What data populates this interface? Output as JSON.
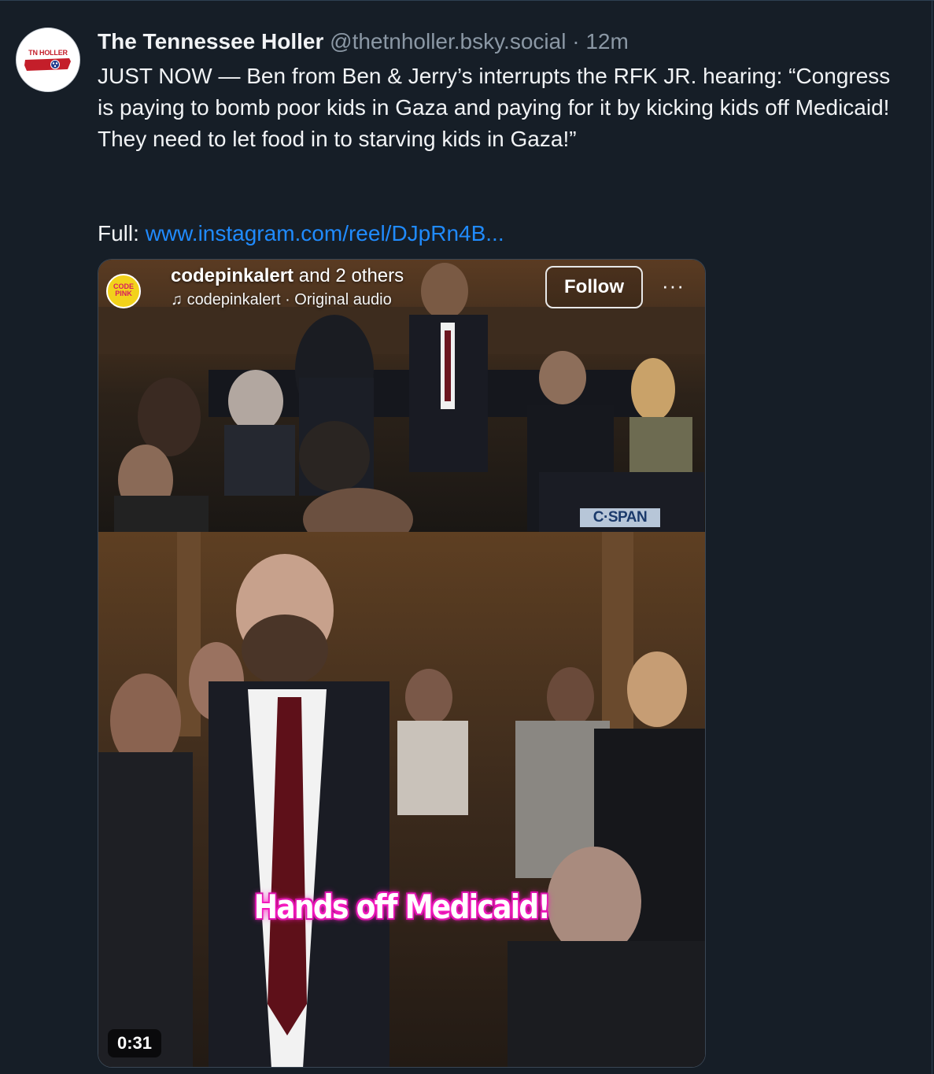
{
  "post": {
    "avatar_text": "TN HOLLER",
    "display_name": "The Tennessee Holler",
    "handle": "@thetnholler.bsky.social",
    "separator": "·",
    "time": "12m",
    "text": "JUST NOW — Ben from Ben & Jerry’s interrupts the RFK JR. hearing: “Congress is paying to bomb poor kids in Gaza and paying for it by kicking kids off Medicaid! They need to let food in to starving kids in Gaza!”",
    "full_label": "Full:",
    "link_text": "www.instagram.com/reel/DJpRn4B..."
  },
  "video": {
    "avatar_text": "CODE PINK",
    "user": "codepinkalert",
    "user_suffix": "and 2 others",
    "audio": "codepinkalert · Original audio",
    "follow_label": "Follow",
    "more_label": "···",
    "watermark": "C·SPAN",
    "caption": "Hands off Medicaid!",
    "duration": "0:31"
  },
  "colors": {
    "background": "#161e27",
    "text": "#f1f3f5",
    "muted": "#8b98a5",
    "link": "#208bfe",
    "caption_glow": "#ff1fc7"
  },
  "icons": {
    "music": "music-note-icon",
    "more": "more-dots-icon"
  }
}
